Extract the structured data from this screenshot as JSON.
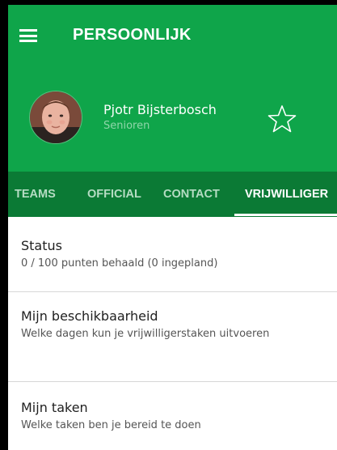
{
  "clipped_title": "Vrijwillig",
  "appbar": {
    "title": "PERSOONLIJK",
    "background": "#0fa54a"
  },
  "profile": {
    "name": "Pjotr Bijsterbosch",
    "subtitle": "Senioren",
    "favorite_icon": "star-outline-icon"
  },
  "tabs": [
    {
      "label": "TEAMS",
      "active": false
    },
    {
      "label": "OFFICIAL",
      "active": false
    },
    {
      "label": "CONTACT",
      "active": false
    },
    {
      "label": "VRIJWILLIGER",
      "active": true
    }
  ],
  "tab_colors": {
    "bar": "#0b7a35",
    "active": "#ffffff",
    "inactive": "#b5dcc3"
  },
  "items": [
    {
      "title": "Status",
      "subtitle": "0 / 100 punten behaald (0 ingepland)"
    },
    {
      "title": "Mijn beschikbaarheid",
      "subtitle": "Welke dagen kun je vrijwilligerstaken uitvoeren"
    },
    {
      "title": "Mijn taken",
      "subtitle": "Welke taken ben je bereid te doen"
    }
  ]
}
